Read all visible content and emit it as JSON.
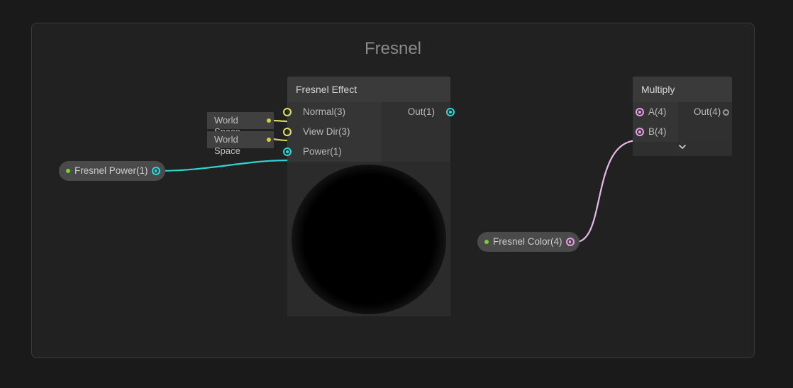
{
  "group": {
    "title": "Fresnel"
  },
  "nodes": {
    "fresnel_effect": {
      "header": "Fresnel Effect",
      "inputs": {
        "normal": "Normal(3)",
        "view_dir": "View Dir(3)",
        "power": "Power(1)"
      },
      "outputs": {
        "out": "Out(1)"
      },
      "normal_space": "World Space",
      "viewdir_space": "World Space"
    },
    "multiply": {
      "header": "Multiply",
      "inputs": {
        "a": "A(4)",
        "b": "B(4)"
      },
      "outputs": {
        "out": "Out(4)"
      }
    }
  },
  "properties": {
    "fresnel_power": "Fresnel Power(1)",
    "fresnel_color": "Fresnel Color(4)"
  }
}
